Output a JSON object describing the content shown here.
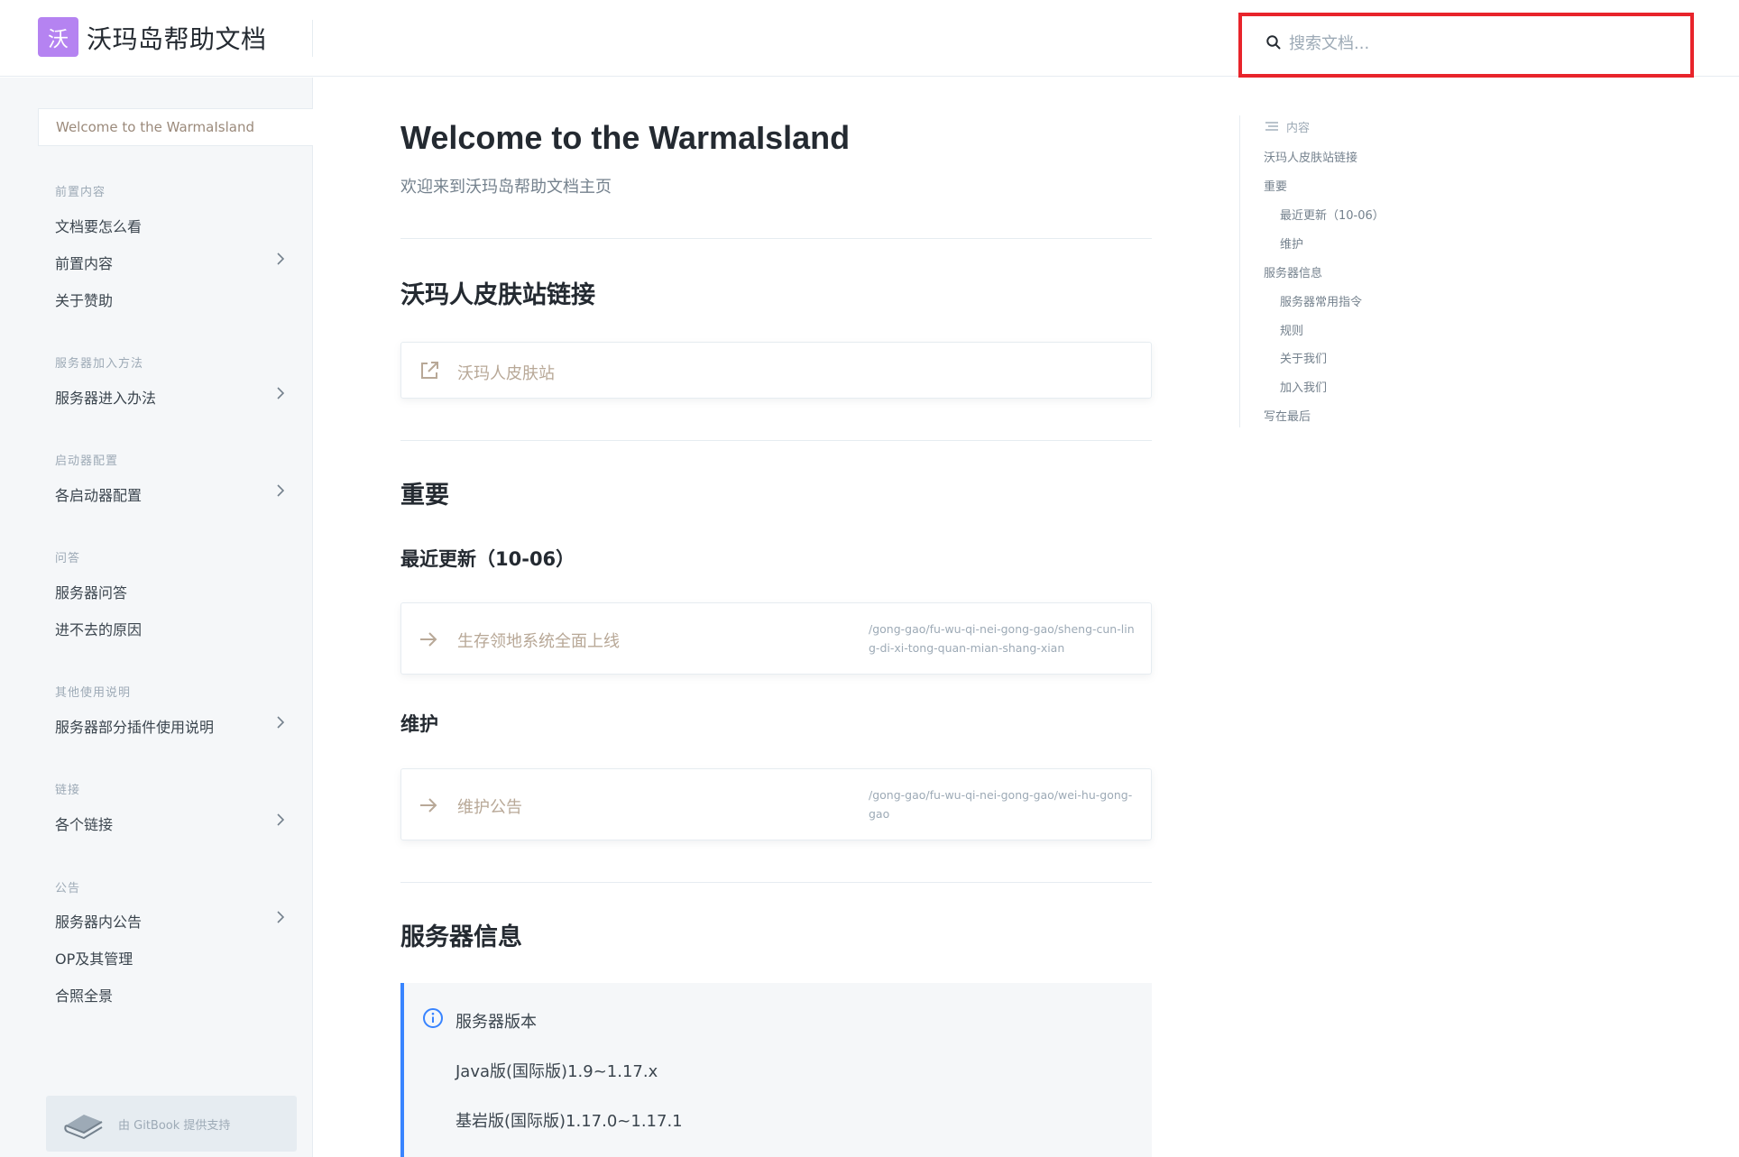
{
  "header": {
    "logo_char": "沃",
    "site_title": "沃玛岛帮助文档",
    "search_placeholder": "搜索文档..."
  },
  "sidebar": {
    "active_page": "Welcome to the WarmaIsland",
    "groups": [
      {
        "title": "前置内容",
        "items": [
          {
            "label": "文档要怎么看",
            "has_children": false
          },
          {
            "label": "前置内容",
            "has_children": true
          },
          {
            "label": "关于赞助",
            "has_children": false
          }
        ]
      },
      {
        "title": "服务器加入方法",
        "items": [
          {
            "label": "服务器进入办法",
            "has_children": true
          }
        ]
      },
      {
        "title": "启动器配置",
        "items": [
          {
            "label": "各启动器配置",
            "has_children": true
          }
        ]
      },
      {
        "title": "问答",
        "items": [
          {
            "label": "服务器问答",
            "has_children": false
          },
          {
            "label": "进不去的原因",
            "has_children": false
          }
        ]
      },
      {
        "title": "其他使用说明",
        "items": [
          {
            "label": "服务器部分插件使用说明",
            "has_children": true
          }
        ]
      },
      {
        "title": "链接",
        "items": [
          {
            "label": "各个链接",
            "has_children": true
          }
        ]
      },
      {
        "title": "公告",
        "items": [
          {
            "label": "服务器内公告",
            "has_children": true
          },
          {
            "label": "OP及其管理",
            "has_children": false
          },
          {
            "label": "合照全景",
            "has_children": false
          }
        ]
      }
    ],
    "footer_badge": "由 GitBook 提供支持"
  },
  "main": {
    "title": "Welcome to the WarmaIsland",
    "subtitle": "欢迎来到沃玛岛帮助文档主页",
    "sections": {
      "skin_heading": "沃玛人皮肤站链接",
      "skin_card_label": "沃玛人皮肤站",
      "important_heading": "重要",
      "recent_heading": "最近更新（10-06）",
      "recent_card_label": "生存领地系统全面上线",
      "recent_card_path": "/gong-gao/fu-wu-qi-nei-gong-gao/sheng-cun-ling-di-xi-tong-quan-mian-shang-xian",
      "maint_heading": "维护",
      "maint_card_label": "维护公告",
      "maint_card_path": "/gong-gao/fu-wu-qi-nei-gong-gao/wei-hu-gong-gao",
      "server_heading": "服务器信息",
      "hint_title": "服务器版本",
      "hint_lines": [
        "Java版(国际版)1.9~1.17.x",
        "基岩版(国际版)1.17.0~1.17.1"
      ]
    }
  },
  "toc": {
    "heading": "内容",
    "items": [
      {
        "label": "沃玛人皮肤站链接",
        "level": 1
      },
      {
        "label": "重要",
        "level": 1
      },
      {
        "label": "最近更新（10-06）",
        "level": 2
      },
      {
        "label": "维护",
        "level": 2
      },
      {
        "label": "服务器信息",
        "level": 1
      },
      {
        "label": "服务器常用指令",
        "level": 2
      },
      {
        "label": "规则",
        "level": 2
      },
      {
        "label": "关于我们",
        "level": 2
      },
      {
        "label": "加入我们",
        "level": 2
      },
      {
        "label": "写在最后",
        "level": 1
      }
    ]
  },
  "colors": {
    "accent": "#3884ff",
    "logo_bg": "#b583f1",
    "search_highlight": "#e8242b",
    "card_label": "#b8a897"
  }
}
